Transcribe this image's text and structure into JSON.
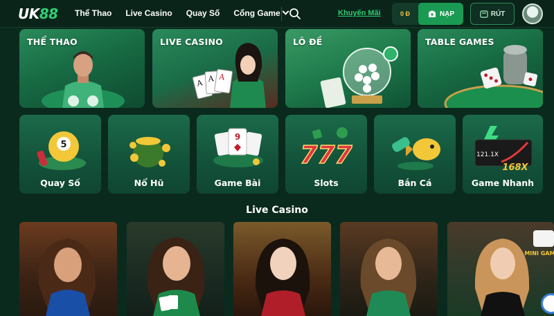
{
  "brand": {
    "logo_main": "UK",
    "logo_num": "88"
  },
  "nav": [
    {
      "label": "Thể Thao"
    },
    {
      "label": "Live Casino"
    },
    {
      "label": "Quay Số"
    },
    {
      "label": "Cổng Game"
    }
  ],
  "header": {
    "promo_label": "Khuyến Mãi",
    "balance": "0 Đ",
    "deposit_label": "NẠP",
    "withdraw_label": "RÚT"
  },
  "big_categories": [
    {
      "label": "THỂ THAO"
    },
    {
      "label": "LIVE CASINO"
    },
    {
      "label": "LÔ ĐỀ"
    },
    {
      "label": "TABLE GAMES"
    }
  ],
  "small_categories": [
    {
      "label": "Quay Số",
      "number": "5"
    },
    {
      "label": "Nổ Hũ"
    },
    {
      "label": "Game Bài",
      "card": "9"
    },
    {
      "label": "Slots",
      "digits": "777"
    },
    {
      "label": "Bắn Cá"
    },
    {
      "label": "Game Nhanh",
      "badge": "168X",
      "multiplier": "121.1X"
    }
  ],
  "live_casino": {
    "title": "Live Casino",
    "mini_games_badge": "MINI GAMES"
  },
  "icons": [
    "search-icon",
    "wallet-icon",
    "withdraw-icon",
    "chevron-down-icon",
    "avatar",
    "chat-fab-icon"
  ],
  "colors": {
    "accent": "#2fcf72",
    "background": "#0b2a1e",
    "deposit": "#1a9a52",
    "balance": "#f5c84a"
  }
}
